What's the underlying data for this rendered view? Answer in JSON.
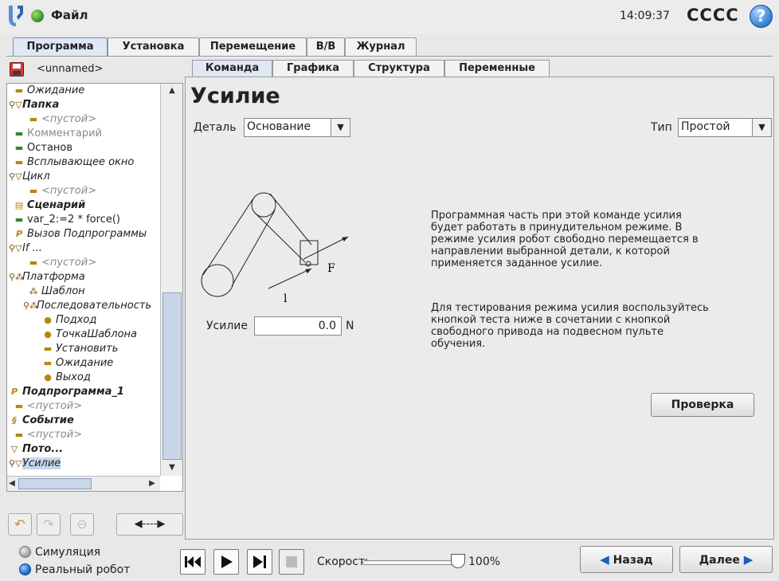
{
  "titlebar": {
    "file_label": "Файл",
    "clock": "14:09:37",
    "robot_name": "CCCC",
    "help_label": "?"
  },
  "main_tabs": [
    "Программа",
    "Установка",
    "Перемещение",
    "В/В",
    "Журнал"
  ],
  "main_tab_active": "Программа",
  "program": {
    "name": "<unnamed>"
  },
  "tree": {
    "items": [
      {
        "label": "Ожидание",
        "icon": "dash-icon"
      },
      {
        "label": "Папка",
        "icon": "folder-triangle-icon"
      },
      {
        "label": "<пустой>",
        "icon": "dash-icon"
      },
      {
        "label": "Комментарий",
        "icon": "dash-icon"
      },
      {
        "label": "Останов",
        "icon": "dash-icon"
      },
      {
        "label": "Всплывающее окно",
        "icon": "dash-icon"
      },
      {
        "label": "Цикл",
        "icon": "folder-triangle-icon"
      },
      {
        "label": "<пустой>",
        "icon": "dash-icon"
      },
      {
        "label": "Сценарий",
        "icon": "script-icon"
      },
      {
        "label": "var_2:=2 * force()",
        "icon": "dash-icon"
      },
      {
        "label": "Вызов Подпрограммы",
        "icon": "subprogram-icon"
      },
      {
        "label": "If ...",
        "icon": "folder-triangle-icon"
      },
      {
        "label": "<пустой>",
        "icon": "dash-icon"
      },
      {
        "label": "Платформа",
        "icon": "pallet-icon"
      },
      {
        "label": "Шаблон",
        "icon": "pallet-icon"
      },
      {
        "label": "Последовательность",
        "icon": "pallet-icon"
      },
      {
        "label": "Подход",
        "icon": "point-icon"
      },
      {
        "label": "ТочкаШаблона",
        "icon": "point-icon"
      },
      {
        "label": "Установить",
        "icon": "dash-icon"
      },
      {
        "label": "Ожидание",
        "icon": "dash-icon"
      },
      {
        "label": "Выход",
        "icon": "point-icon"
      },
      {
        "label": "Подпрограмма_1",
        "icon": "subprogram-icon"
      },
      {
        "label": "<пустой>",
        "icon": "dash-icon"
      },
      {
        "label": "Событие",
        "icon": "event-icon"
      },
      {
        "label": "<пустой>",
        "icon": "dash-icon"
      },
      {
        "label": "Пото...",
        "icon": "folder-triangle-icon"
      },
      {
        "label": "Усилие",
        "icon": "folder-triangle-icon"
      }
    ]
  },
  "sub_tabs": [
    "Команда",
    "Графика",
    "Структура",
    "Переменные"
  ],
  "sub_tab_active": "Команда",
  "command": {
    "title": "Усилие",
    "detail_label": "Деталь",
    "detail_value": "Основание",
    "type_label": "Тип",
    "type_value": "Простой",
    "force_label": "Усилие",
    "force_value": "0.0",
    "force_unit": "N",
    "diagram_label_f": "F",
    "diagram_label_l": "l",
    "description_1": "Программная часть при этой команде усилия будет работать в принудительном режиме. В режиме усилия робот свободно перемещается в направлении выбранной детали, к которой применяется заданное усилие.",
    "description_2": "Для тестирования режима усилия воспользуйтесь кнопкой теста ниже в сочетании с кнопкой свободного привода на подвесном пульте обучения.",
    "test_button": "Проверка"
  },
  "bottom": {
    "simulation_label": "Симуляция",
    "real_robot_label": "Реальный робот",
    "speed_label": "Скорость",
    "speed_value": "100%",
    "speed_fraction": 1.0,
    "back_button": "Назад",
    "next_button": "Далее"
  },
  "colors": {
    "accent_blue": "#1a5fb8",
    "status_green": "#2f8a1c",
    "selected_row": "#c6d7ec"
  }
}
